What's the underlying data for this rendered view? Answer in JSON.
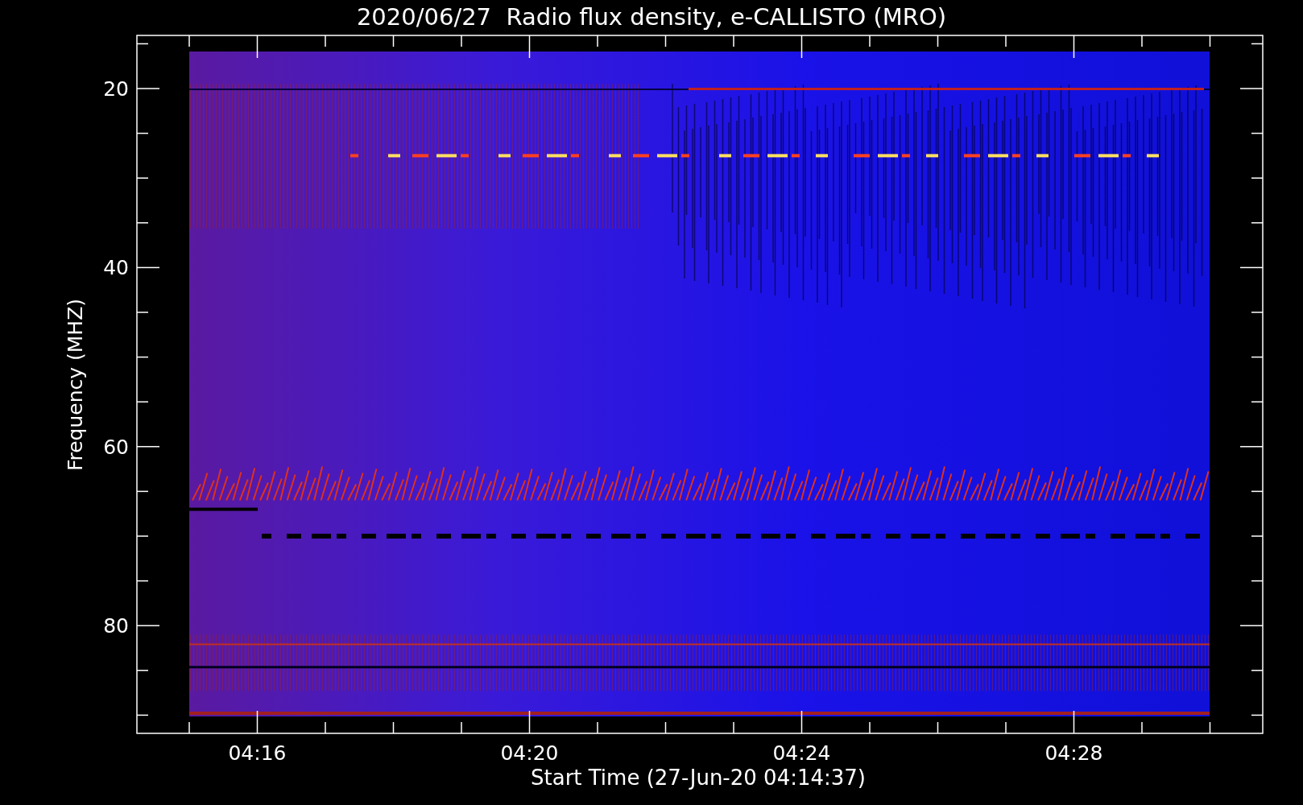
{
  "title": "2020/06/27  Radio flux density, e-CALLISTO (MRO)",
  "y_axis": {
    "label": "Frequency (MHZ)",
    "ticks": [
      "20",
      "40",
      "60",
      "80"
    ]
  },
  "x_axis": {
    "label": "Start Time (27-Jun-20 04:14:37)",
    "ticks": [
      "04:16",
      "04:20",
      "04:24",
      "04:28"
    ]
  }
}
